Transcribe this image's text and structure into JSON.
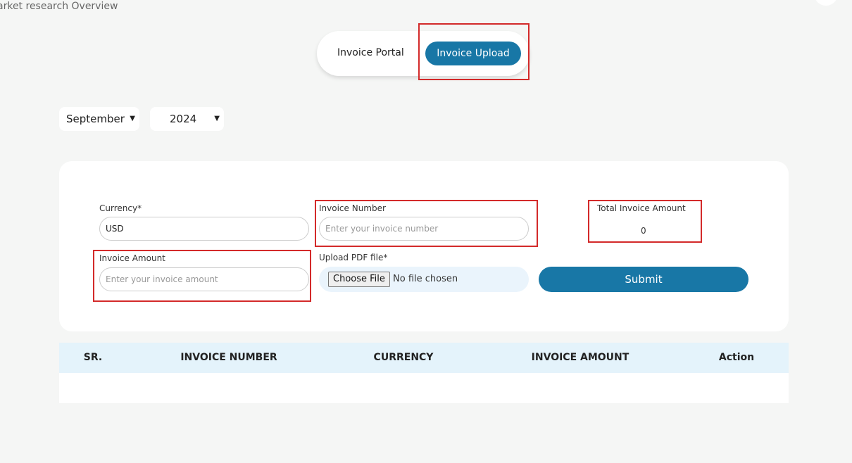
{
  "breadcrumb": "arket research Overview",
  "tabs": [
    {
      "label": "Invoice Portal",
      "active": false
    },
    {
      "label": "Invoice Upload",
      "active": true
    }
  ],
  "filters": {
    "month": "September",
    "year": "2024"
  },
  "form": {
    "currency_label": "Currency*",
    "currency_value": "USD",
    "invoice_number_label": "Invoice Number",
    "invoice_number_placeholder": "Enter your invoice number",
    "total_label": "Total Invoice Amount",
    "total_value": "0",
    "invoice_amount_label": "Invoice Amount",
    "invoice_amount_placeholder": "Enter your invoice amount",
    "upload_label": "Upload PDF file*",
    "choose_file": "Choose File",
    "no_file": "No file chosen",
    "submit": "Submit"
  },
  "table": {
    "headers": [
      "SR.",
      "INVOICE NUMBER",
      "CURRENCY",
      "INVOICE AMOUNT",
      "Action"
    ],
    "rows": []
  },
  "colors": {
    "accent": "#1877a6",
    "highlight": "#d32a2a"
  }
}
